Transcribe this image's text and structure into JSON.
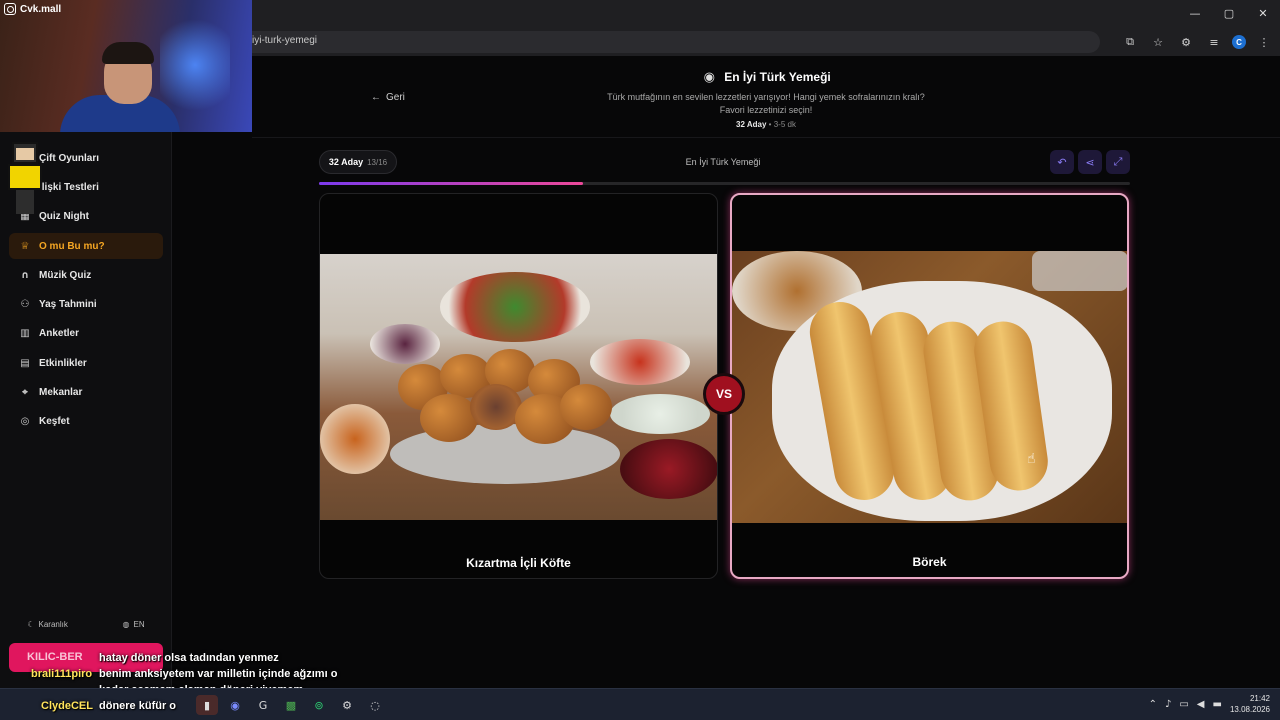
{
  "browser": {
    "url": "iyi-turk-yemegi",
    "window_controls": [
      "—",
      "▢",
      "✕"
    ],
    "profile_initial": "C"
  },
  "streamer": {
    "handle": "Cvk.mall"
  },
  "sidebar": {
    "items": [
      {
        "label": "Çift Oyunları",
        "icon": "gamepad-icon"
      },
      {
        "label": "İlişki Testleri",
        "icon": "heart-icon"
      },
      {
        "label": "Quiz Night",
        "icon": "grid-icon"
      },
      {
        "label": "O mu Bu mu?",
        "icon": "trophy-icon",
        "active": true
      },
      {
        "label": "Müzik Quiz",
        "icon": "headphones-icon"
      },
      {
        "label": "Yaş Tahmini",
        "icon": "users-icon"
      },
      {
        "label": "Anketler",
        "icon": "bar-chart-icon"
      },
      {
        "label": "Etkinlikler",
        "icon": "calendar-icon"
      },
      {
        "label": "Mekanlar",
        "icon": "map-pin-icon"
      },
      {
        "label": "Keşfet",
        "icon": "compass-icon"
      }
    ],
    "theme_label": "Karanlık",
    "lang_label": "EN"
  },
  "header": {
    "back_label": "Geri",
    "title_pre": "En İyi ",
    "title_highlight": "Türk Yemeği",
    "description_line1": "Türk mutfağının en sevilen lezzetleri yarışıyor! Hangi yemek sofralarınızın kralı?",
    "description_line2": "Favori lezzetinizi seçin!",
    "candidates": "32 Aday",
    "duration": "3-5 dk"
  },
  "status": {
    "round_label": "32 Aday",
    "progress_text": "13/16",
    "progress_fraction": 0.8125,
    "center_title": "En İyi Türk Yemeği"
  },
  "matchup": {
    "left": {
      "label": "Kızartma İçli Köfte"
    },
    "right": {
      "label": "Börek"
    },
    "vs_label": "VS"
  },
  "chat": {
    "badge_text": "KILIC-BER",
    "messages": [
      {
        "user": "",
        "text": "hatay döner olsa tadından yenmez"
      },
      {
        "user": "brali111piro",
        "text": "benim anksiyetem var milletin içinde ağzımı o"
      },
      {
        "user": "",
        "text": "kadar açamam alaman döneri yiyemem"
      },
      {
        "user": "ClydeCEL",
        "text": "dönere küfür o"
      }
    ]
  },
  "taskbar": {
    "time": "21:42",
    "date": "13.08.2026"
  },
  "colors": {
    "accent_active": "#f5a623",
    "vs_red": "#a0101f",
    "progress_start": "#7c3aed",
    "progress_end": "#ec4899"
  }
}
